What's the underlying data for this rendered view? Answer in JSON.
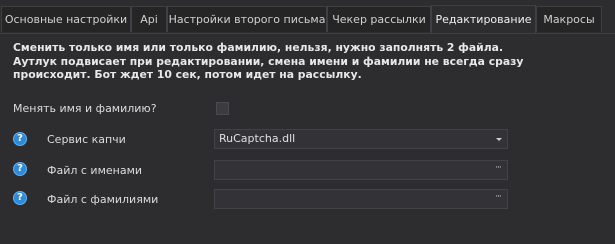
{
  "tabs": [
    {
      "label": "Основные настройки",
      "active": false
    },
    {
      "label": "Api",
      "active": false
    },
    {
      "label": "Настройки второго письма",
      "active": false
    },
    {
      "label": "Чекер рассылки",
      "active": false
    },
    {
      "label": "Редактирование",
      "active": true
    },
    {
      "label": "Макросы",
      "active": false
    }
  ],
  "notice": {
    "line1": "Сменить только имя или только фамилию, нельзя, нужно заполнять 2 файла.",
    "line2": "Аутлук подвисает при редактировании, смена имени и фамилии не всегда сразу",
    "line3": "происходит. Бот ждет 10 сек, потом идет на рассылку."
  },
  "settings": {
    "change_name_label": "Менять имя и фамилию?",
    "change_name_checked": false,
    "captcha_label": "Сервис капчи",
    "captcha_value": "RuCaptcha.dll",
    "names_file_label": "Файл с именами",
    "names_file_value": "",
    "surnames_file_label": "Файл с фамилиями",
    "surnames_file_value": "",
    "help_glyph": "?",
    "browse_glyph": "···"
  },
  "colors": {
    "background": "#2d2d30",
    "tab_inactive": "#252526",
    "field_bg": "#333337",
    "help_icon": "#2f8ad8"
  }
}
